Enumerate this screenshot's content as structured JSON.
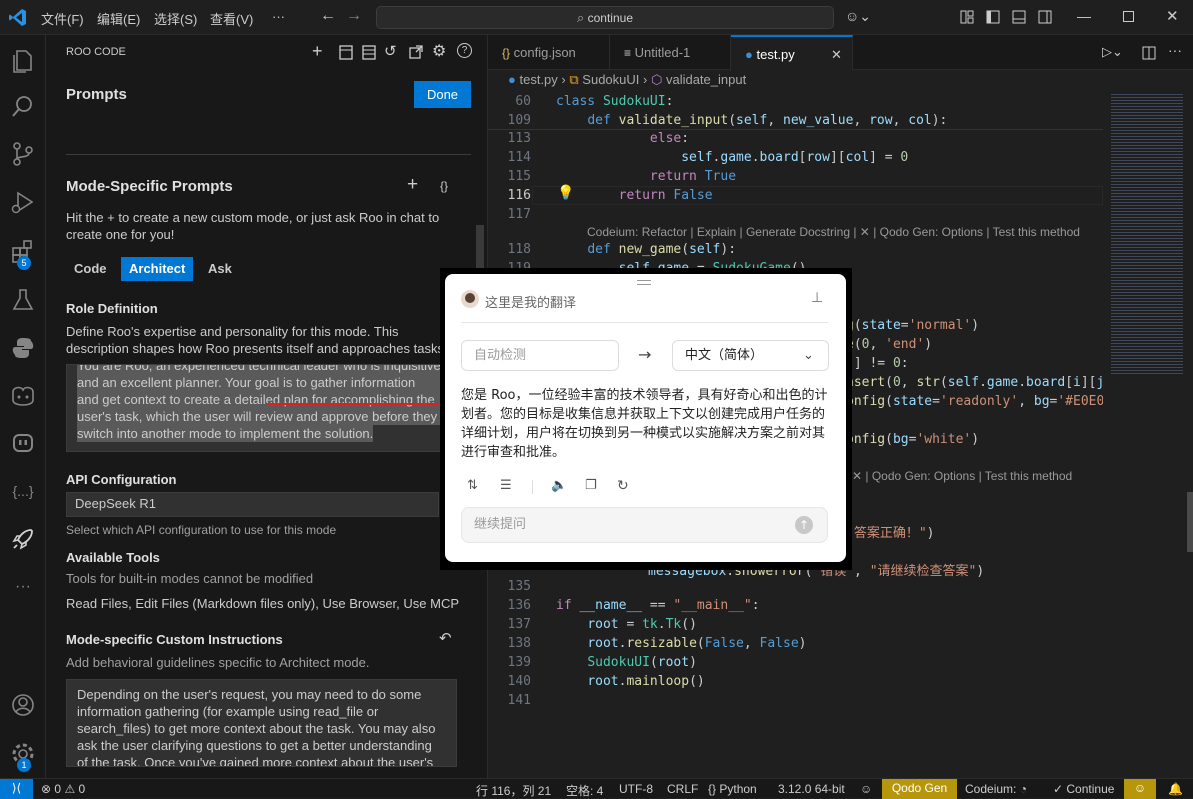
{
  "titlebar": {
    "menus": [
      "文件(F)",
      "编辑(E)",
      "选择(S)",
      "查看(V)",
      "···"
    ],
    "search_text": "continue"
  },
  "activity_bar": {
    "icons": [
      "files-icon",
      "search-icon",
      "source-control-icon",
      "run-debug-icon",
      "extensions-icon",
      "flask-icon",
      "python-icon",
      "copilot-icon",
      "robot-icon",
      "json-icon",
      "rocket-icon",
      "more-icon",
      "account-icon",
      "settings-icon"
    ],
    "extensions_badge": "5",
    "settings_badge": "1"
  },
  "panel": {
    "header": "ROO CODE",
    "title": "Prompts",
    "done_label": "Done",
    "mode_specific_title": "Mode-Specific Prompts",
    "mode_specific_desc": "Hit the + to create a new custom mode, or just ask Roo in chat to create one for you!",
    "mode_tabs": [
      "Code",
      "Architect",
      "Ask"
    ],
    "role_title": "Role Definition",
    "role_desc": "Define Roo's expertise and personality for this mode. This description shapes how Roo presents itself and approaches tasks.",
    "role_text_lines": [
      "You are Roo, an experienced technical leader who is inquisitive",
      "and an excellent planner. Your goal is to gather information",
      "and get context to create a detailed plan for accomplishing the",
      "user's task, which the user will review and approve before they",
      "switch into another mode to implement the solution."
    ],
    "api_title": "API Configuration",
    "api_value": "DeepSeek R1",
    "api_desc": "Select which API configuration to use for this mode",
    "tools_title": "Available Tools",
    "tools_desc": "Tools for built-in modes cannot be modified",
    "tools_list": "Read Files, Edit Files (Markdown files only), Use Browser, Use MCP",
    "custom_title": "Mode-specific Custom Instructions",
    "custom_desc": "Add behavioral guidelines specific to Architect mode.",
    "custom_text_lines": [
      "Depending on the user's request, you may need to do some",
      "information gathering (for example using read_file or",
      "search_files) to get more context about the task. You may also",
      "ask the user clarifying questions to get a better understanding",
      "of the task. Once you've gained more context about the user's"
    ]
  },
  "editor": {
    "tabs": [
      {
        "label": "config.json",
        "icon": "json-file-icon"
      },
      {
        "label": "Untitled-1",
        "icon": "text-file-icon"
      },
      {
        "label": "test.py",
        "icon": "python-file-icon"
      }
    ],
    "breadcrumb": [
      "test.py",
      "SudokuUI",
      "validate_input"
    ],
    "lens_text": "Codeium: Refactor | Explain | Generate Docstring | ✕ | Qodo Gen: Options | Test this method",
    "lens_text_2": "✕ | Qodo Gen: Options | Test this method",
    "line_numbers": [
      "60",
      "109",
      "113",
      "114",
      "115",
      "116",
      "117",
      "118",
      "119",
      "135",
      "136",
      "137",
      "138",
      "139",
      "140",
      "141"
    ]
  },
  "popup": {
    "title": "这里是我的翻译",
    "source_lang": "自动检测",
    "target_lang": "中文（简体）",
    "result": "您是 Roo，一位经验丰富的技术领导者，具有好奇心和出色的计划者。您的目标是收集信息并获取上下文以创建完成用户任务的详细计划，用户将在切换到另一种模式以实施解决方案之前对其进行审查和批准。",
    "followup_placeholder": "继续提问"
  },
  "statusbar": {
    "remote": "⟩⟨",
    "errors": "0",
    "warnings": "0",
    "position": "行 116，列 21",
    "spaces": "空格: 4",
    "encoding": "UTF-8",
    "eol": "CRLF",
    "language": "Python",
    "interpreter": "3.12.0 64-bit",
    "qodo": "Qodo Gen",
    "codeium": "Codeium:",
    "continue": "✓ Continue"
  }
}
